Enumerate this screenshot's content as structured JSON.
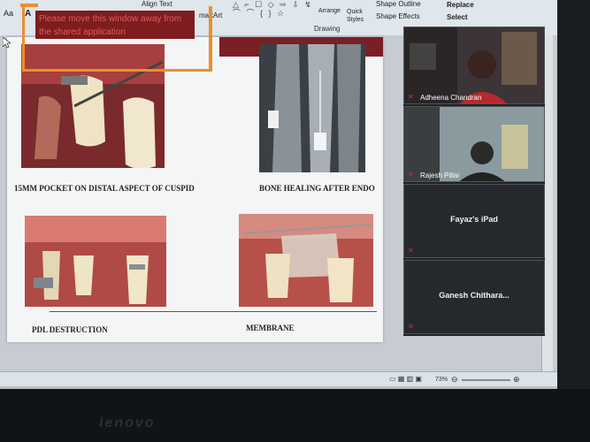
{
  "ribbon": {
    "align_text": "Align Text",
    "smartart": "martArt",
    "arrange": "Arrange",
    "quick_styles": "Quick Styles",
    "shape_outline": "Shape Outline",
    "shape_effects": "Shape Effects",
    "replace": "Replace",
    "select": "Select",
    "group_drawing": "Drawing",
    "font_btn": "Aa",
    "shapes_glyphs": "△ ⌐ ☐ ◇ ⇨ ⇩ ↯ ⌒ ⌒ { } ☆"
  },
  "warning": {
    "text": "Please move this window away from the shared application"
  },
  "slide": {
    "captions": [
      "15MM POCKET ON DISTAL ASPECT OF CUSPID",
      "BONE HEALING AFTER ENDO",
      "PDL DESTRUCTION",
      "MEMBRANE"
    ]
  },
  "video": {
    "participants": [
      {
        "name": "Adheena Chandran",
        "muted": true
      },
      {
        "name": "Rajesh Pillai",
        "muted": true
      },
      {
        "name": "Fayaz's iPad",
        "muted": true
      },
      {
        "name": "Ganesh  Chithara...",
        "muted": true
      }
    ]
  },
  "status": {
    "zoom": "73%"
  },
  "laptop": {
    "brand": "lenovo"
  },
  "colors": {
    "warning_bg": "#7d1d20",
    "frame": "#e8902e",
    "slide_accent": "#7a1f24"
  }
}
